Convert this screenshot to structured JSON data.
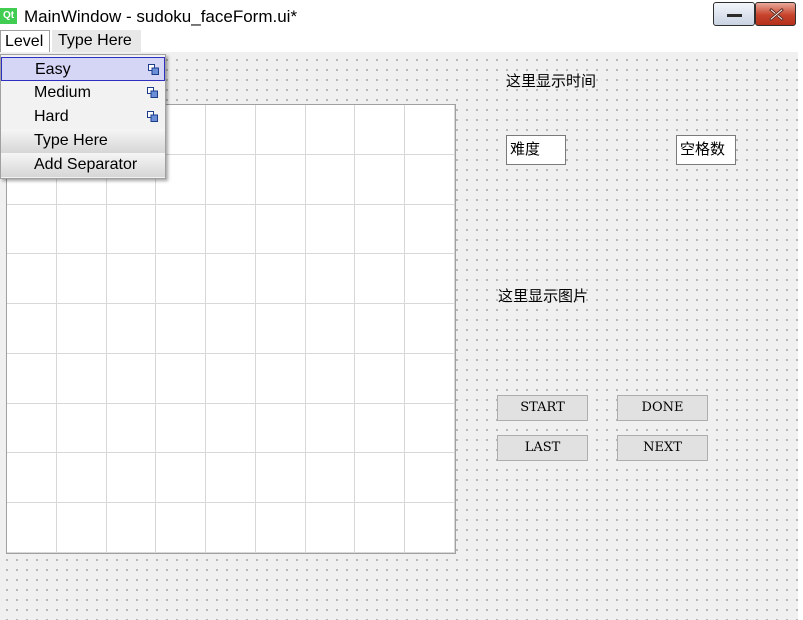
{
  "window": {
    "app_icon_text": "Qt",
    "title": "MainWindow - sudoku_faceForm.ui*"
  },
  "menubar": {
    "level": "Level",
    "type_here": "Type Here"
  },
  "dropdown": {
    "items": [
      {
        "label": "Easy"
      },
      {
        "label": "Medium"
      },
      {
        "label": "Hard"
      },
      {
        "label": "Type Here"
      },
      {
        "label": "Add Separator"
      }
    ]
  },
  "labels": {
    "time": "这里显示时间",
    "image": "这里显示图片"
  },
  "fields": {
    "difficulty": "难度",
    "blanks": "空格数"
  },
  "buttons": {
    "start": "START",
    "done": "DONE",
    "last": "LAST",
    "next": "NEXT"
  },
  "grid": {
    "rows": 9,
    "columns": 9
  },
  "colors": {
    "accent": "#3030c0",
    "qt_green": "#41cd52",
    "close_red": "#c7432b"
  }
}
